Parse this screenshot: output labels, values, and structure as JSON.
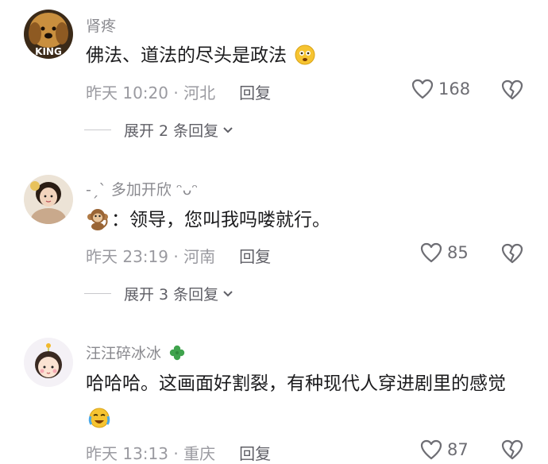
{
  "comments": [
    {
      "username": "肾疼",
      "avatar_text": "KING",
      "text": "佛法、道法的尽头是政法",
      "time": "昨天 10:20 · 河北",
      "reply_label": "回复",
      "likes": "168",
      "expand_label": "展开 2 条回复"
    },
    {
      "username": "-ˏˋ 多加开欣 ᵔᴗᵔ",
      "text": "：领导，您叫我吗喽就行。",
      "time": "昨天 23:19 · 河南",
      "reply_label": "回复",
      "likes": "85",
      "expand_label": "展开 3 条回复"
    },
    {
      "username": "汪汪碎冰冰",
      "text": "哈哈哈。这画面好割裂，有种现代人穿进剧里的感觉",
      "time": "昨天 13:13 · 重庆",
      "reply_label": "回复",
      "likes": "87"
    }
  ],
  "colors": {
    "text": "#1c1c1e",
    "meta": "#9a9aa0",
    "username": "#8a8a8f"
  },
  "icons": [
    "heart-outline-icon",
    "broken-heart-icon",
    "chevron-down-icon",
    "monkey-emoji-icon",
    "clover-icon",
    "crying-emoji-icon"
  ]
}
